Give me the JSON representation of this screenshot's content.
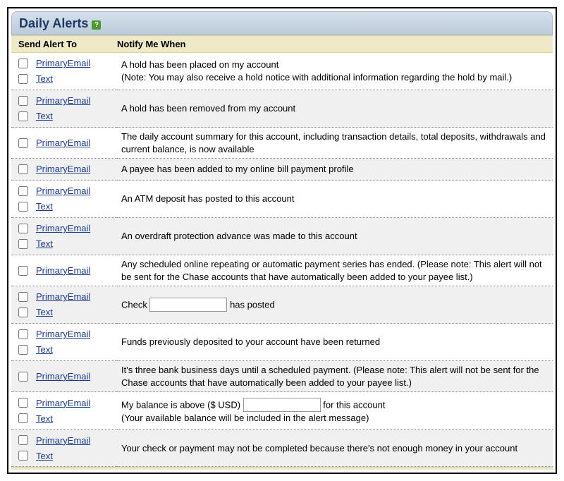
{
  "header": {
    "title": "Daily Alerts"
  },
  "columns": {
    "send_alert_to": "Send Alert To",
    "notify_me_when": "Notify Me When"
  },
  "labels": {
    "primary_email": "PrimaryEmail",
    "text_msg": "Text"
  },
  "alerts": [
    {
      "options": [
        "email",
        "text"
      ],
      "desc": "A hold has been placed on my account\n(Note: You may also receive a hold notice with additional information regarding the hold by mail.)"
    },
    {
      "options": [
        "email",
        "text"
      ],
      "desc": "A hold has been removed from my account"
    },
    {
      "options": [
        "email"
      ],
      "desc": "The daily account summary for this account, including transaction details, total deposits, withdrawals and current balance, is now available"
    },
    {
      "options": [
        "email"
      ],
      "desc": "A payee has been added to my online bill payment profile"
    },
    {
      "options": [
        "email",
        "text"
      ],
      "desc": "An ATM deposit has posted to this account"
    },
    {
      "options": [
        "email",
        "text"
      ],
      "desc": "An overdraft protection advance was made to this account"
    },
    {
      "options": [
        "email"
      ],
      "desc": "Any scheduled online repeating or automatic payment series has ended. (Please note: This alert will not be sent for the Chase accounts that have automatically been added to your payee list.)"
    },
    {
      "options": [
        "email",
        "text"
      ],
      "desc_parts": {
        "before": "Check ",
        "after": " has posted"
      },
      "input": true
    },
    {
      "options": [
        "email",
        "text"
      ],
      "desc": "Funds previously deposited to your account have been returned"
    },
    {
      "options": [
        "email"
      ],
      "desc": "It's three bank business days until a scheduled payment. (Please note: This alert will not be sent for the Chase accounts that have automatically been added to your payee list.)"
    },
    {
      "options": [
        "email",
        "text"
      ],
      "desc_lines": [
        {
          "before": "My balance is above ($ USD) ",
          "input": true,
          "after": " for this account"
        },
        {
          "text": "(Your available balance will be included in the alert message)"
        }
      ]
    },
    {
      "options": [
        "email",
        "text"
      ],
      "desc": "Your check or payment may not be completed because there's not enough money in your account"
    }
  ]
}
